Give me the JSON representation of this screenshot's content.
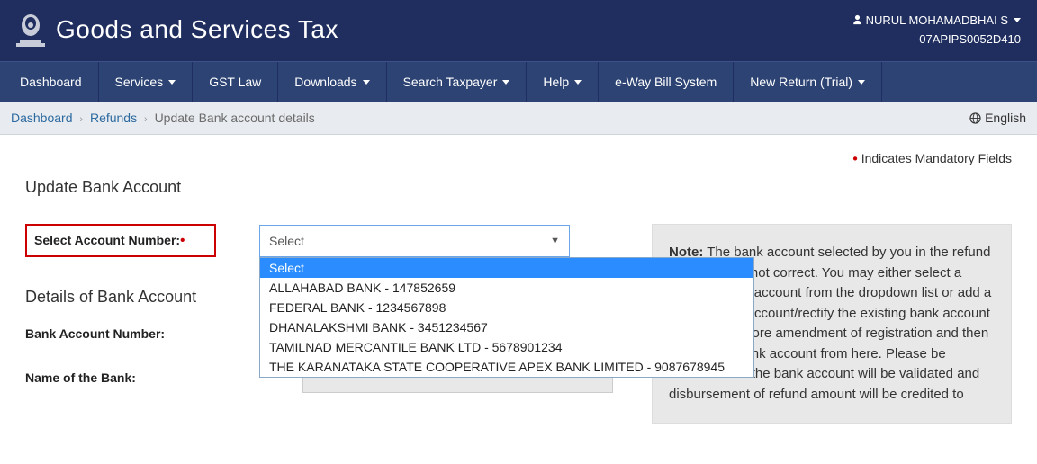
{
  "header": {
    "title": "Goods and Services Tax",
    "user_name": "NURUL MOHAMADBHAI S",
    "user_id": "07APIPS0052D410"
  },
  "nav": {
    "dashboard": "Dashboard",
    "services": "Services",
    "gst_law": "GST Law",
    "downloads": "Downloads",
    "search_taxpayer": "Search Taxpayer",
    "help": "Help",
    "eway": "e-Way Bill System",
    "new_return": "New Return (Trial)"
  },
  "breadcrumb": {
    "dashboard": "Dashboard",
    "refunds": "Refunds",
    "current": "Update Bank account details"
  },
  "language": "English",
  "mandatory_text": "Indicates Mandatory Fields",
  "page_title": "Update Bank Account",
  "form": {
    "select_account_label": "Select Account Number:",
    "select_placeholder": "Select",
    "options": {
      "o0": "Select",
      "o1": "ALLAHABAD BANK - 147852659",
      "o2": "FEDERAL BANK - 1234567898",
      "o3": "DHANALAKSHMI BANK - 3451234567",
      "o4": "TAMILNAD MERCANTILE BANK LTD - 5678901234",
      "o5": "THE KARANATAKA STATE COOPERATIVE APEX BANK LIMITED - 9087678945"
    },
    "details_title": "Details of Bank Account",
    "bank_account_number_label": "Bank Account Number:",
    "name_of_bank_label": "Name of the Bank:"
  },
  "note": {
    "prefix": "Note:",
    "body": " The bank account selected by you in the refund application is not correct. You may either select a different bank account from the dropdown list or add a correct bank account/rectify the existing bank account by filing non-core amendment of registration and then update the bank account from here. Please be informed that the bank account will be validated and disbursement of refund amount will be credited to"
  }
}
